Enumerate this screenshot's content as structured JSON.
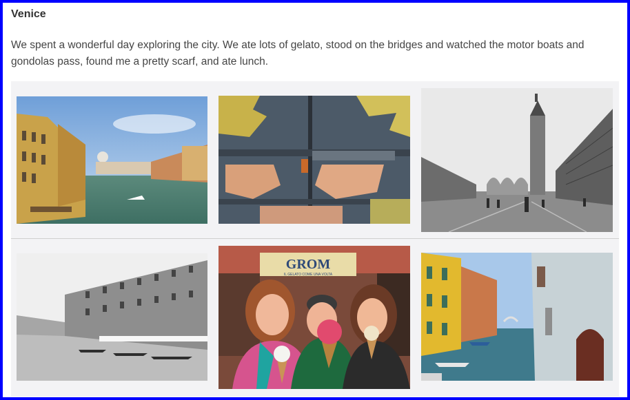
{
  "post": {
    "title": "Venice",
    "body": "We spent a wonderful day exploring the city. We ate lots of gelato, stood on the bridges and watched the motor boats and gondolas pass, found me a pretty scarf, and ate lunch."
  },
  "photos": [
    {
      "id": "grand-canal",
      "subject": "Grand Canal with motor boats"
    },
    {
      "id": "peeling-paint",
      "subject": "Peeling painted wooden door"
    },
    {
      "id": "st-marks-square",
      "subject": "St Mark's Square and Campanile"
    },
    {
      "id": "canal-bw",
      "subject": "Black and white canal with gondolas"
    },
    {
      "id": "gelato-selfie",
      "subject": "Three people holding gelato",
      "sign_text": "GROM",
      "sign_subtext": "IL GELATO COME UNA VOLTA"
    },
    {
      "id": "side-canal",
      "subject": "Narrow canal with boats"
    }
  ],
  "colors": {
    "frame": "#0000ff",
    "gallery_bg": "#f3f3f5"
  }
}
